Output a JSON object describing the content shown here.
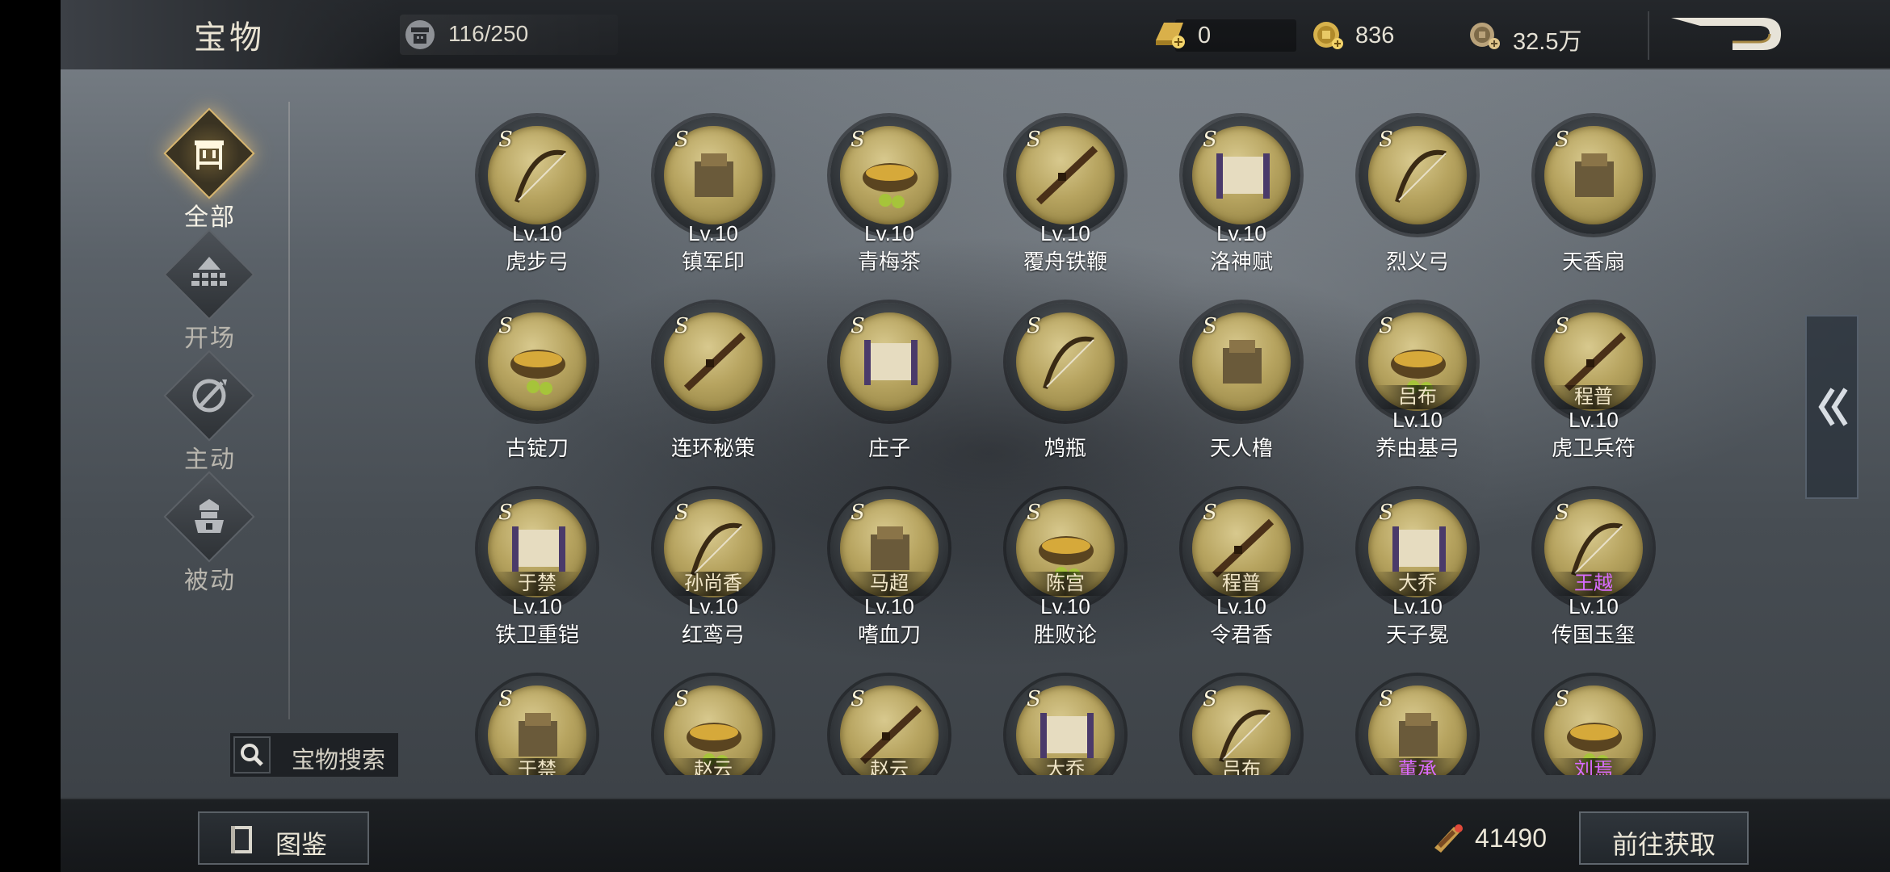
{
  "header": {
    "title": "宝物",
    "capacity": "116/250",
    "currencies": {
      "gold_bar": "0",
      "yuanbao": "836",
      "copper": "32.5万"
    }
  },
  "sidebar": {
    "items": [
      {
        "label": "全部",
        "icon": "treasure-all-icon",
        "active": true
      },
      {
        "label": "开场",
        "icon": "opening-icon",
        "active": false
      },
      {
        "label": "主动",
        "icon": "active-skill-icon",
        "active": false
      },
      {
        "label": "被动",
        "icon": "passive-skill-icon",
        "active": false
      }
    ],
    "search_label": "宝物搜索"
  },
  "treasures": [
    {
      "tier": "S",
      "level": "Lv.10",
      "name": "虎步弓",
      "owner": ""
    },
    {
      "tier": "S",
      "level": "Lv.10",
      "name": "镇军印",
      "owner": ""
    },
    {
      "tier": "S",
      "level": "Lv.10",
      "name": "青梅茶",
      "owner": ""
    },
    {
      "tier": "S",
      "level": "Lv.10",
      "name": "覆舟铁鞭",
      "owner": ""
    },
    {
      "tier": "S",
      "level": "Lv.10",
      "name": "洛神赋",
      "owner": ""
    },
    {
      "tier": "S",
      "level": "",
      "name": "烈义弓",
      "owner": ""
    },
    {
      "tier": "S",
      "level": "",
      "name": "天香扇",
      "owner": ""
    },
    {
      "tier": "S",
      "level": "",
      "name": "古锭刀",
      "owner": ""
    },
    {
      "tier": "S",
      "level": "",
      "name": "连环秘策",
      "owner": ""
    },
    {
      "tier": "S",
      "level": "",
      "name": "庄子",
      "owner": ""
    },
    {
      "tier": "S",
      "level": "",
      "name": "鸩瓶",
      "owner": ""
    },
    {
      "tier": "S",
      "level": "",
      "name": "天人橹",
      "owner": ""
    },
    {
      "tier": "S",
      "level": "Lv.10",
      "name": "养由基弓",
      "owner": "吕布"
    },
    {
      "tier": "S",
      "level": "Lv.10",
      "name": "虎卫兵符",
      "owner": "程普"
    },
    {
      "tier": "S",
      "level": "Lv.10",
      "name": "铁卫重铠",
      "owner": "于禁"
    },
    {
      "tier": "S",
      "level": "Lv.10",
      "name": "红鸾弓",
      "owner": "孙尚香"
    },
    {
      "tier": "S",
      "level": "Lv.10",
      "name": "嗜血刀",
      "owner": "马超"
    },
    {
      "tier": "S",
      "level": "Lv.10",
      "name": "胜败论",
      "owner": "陈宫"
    },
    {
      "tier": "S",
      "level": "Lv.10",
      "name": "令君香",
      "owner": "程普"
    },
    {
      "tier": "S",
      "level": "Lv.10",
      "name": "天子冕",
      "owner": "大乔"
    },
    {
      "tier": "S",
      "level": "Lv.10",
      "name": "传国玉玺",
      "owner": "王越",
      "owner_color": "purple"
    },
    {
      "tier": "S",
      "level": "",
      "name": "",
      "owner": "于禁"
    },
    {
      "tier": "S",
      "level": "",
      "name": "",
      "owner": "赵云"
    },
    {
      "tier": "S",
      "level": "",
      "name": "",
      "owner": "赵云"
    },
    {
      "tier": "S",
      "level": "",
      "name": "",
      "owner": "大乔"
    },
    {
      "tier": "S",
      "level": "",
      "name": "",
      "owner": "吕布"
    },
    {
      "tier": "S",
      "level": "",
      "name": "",
      "owner": "董承",
      "owner_color": "purple"
    },
    {
      "tier": "S",
      "level": "",
      "name": "",
      "owner": "刘焉",
      "owner_color": "purple"
    }
  ],
  "footer": {
    "codex_label": "图鉴",
    "token_value": "41490",
    "acquire_label": "前往获取"
  },
  "colors": {
    "orb_gold": "#b7a460",
    "active_glow": "#d8b66e",
    "purple_name": "#d96bff"
  }
}
